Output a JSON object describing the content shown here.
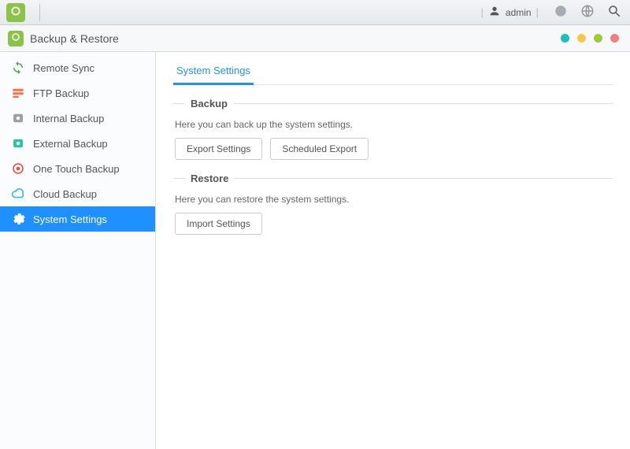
{
  "sysbar": {
    "user_label": "admin"
  },
  "titlebar": {
    "app_title": "Backup & Restore",
    "lights": [
      "teal",
      "yellow",
      "green",
      "red"
    ]
  },
  "sidebar": {
    "items": [
      {
        "label": "Remote Sync",
        "icon": "sync-icon",
        "active": false
      },
      {
        "label": "FTP Backup",
        "icon": "ftp-icon",
        "active": false
      },
      {
        "label": "Internal Backup",
        "icon": "hdd-icon",
        "active": false
      },
      {
        "label": "External Backup",
        "icon": "external-icon",
        "active": false
      },
      {
        "label": "One Touch Backup",
        "icon": "target-icon",
        "active": false
      },
      {
        "label": "Cloud Backup",
        "icon": "cloud-icon",
        "active": false
      },
      {
        "label": "System Settings",
        "icon": "gear-icon",
        "active": true
      }
    ]
  },
  "content": {
    "tabs": [
      {
        "label": "System Settings",
        "active": true
      }
    ],
    "sections": {
      "backup": {
        "legend": "Backup",
        "desc": "Here you can back up the system settings.",
        "buttons": {
          "export": "Export Settings",
          "scheduled": "Scheduled Export"
        }
      },
      "restore": {
        "legend": "Restore",
        "desc": "Here you can restore the system settings.",
        "buttons": {
          "import": "Import Settings"
        }
      }
    }
  }
}
